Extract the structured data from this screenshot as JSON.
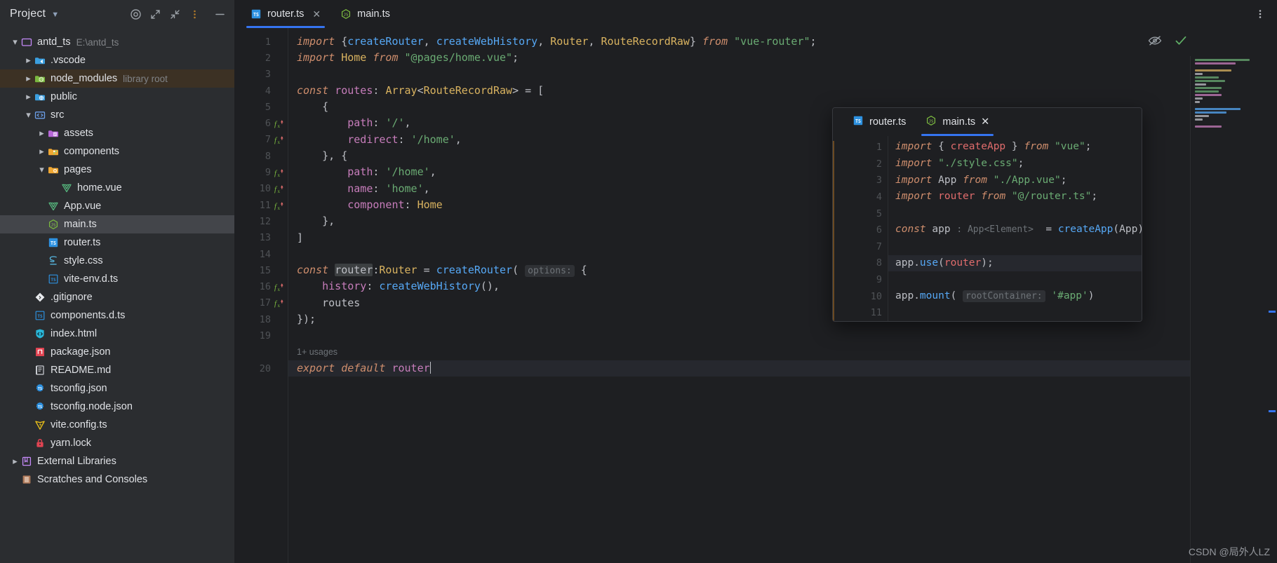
{
  "sidebar": {
    "title": "Project",
    "toolbar_icons": [
      "target-icon",
      "expand-icon",
      "collapse-icon",
      "more-vertical-icon",
      "minimize-icon"
    ],
    "tree": [
      {
        "label": "antd_ts",
        "sub": "E:\\antd_ts",
        "arrow": "down",
        "icon": "folder-module-icon",
        "indent": 0,
        "state": ""
      },
      {
        "label": ".vscode",
        "sub": "",
        "arrow": "right",
        "icon": "folder-vscode-icon",
        "indent": 1,
        "state": ""
      },
      {
        "label": "node_modules",
        "sub": "library root",
        "arrow": "right",
        "icon": "folder-node-icon",
        "indent": 1,
        "state": "sel-brown"
      },
      {
        "label": "public",
        "sub": "",
        "arrow": "right",
        "icon": "folder-web-icon",
        "indent": 1,
        "state": ""
      },
      {
        "label": "src",
        "sub": "",
        "arrow": "down",
        "icon": "folder-source-icon",
        "indent": 1,
        "state": ""
      },
      {
        "label": "assets",
        "sub": "",
        "arrow": "right",
        "icon": "folder-assets-icon",
        "indent": 2,
        "state": ""
      },
      {
        "label": "components",
        "sub": "",
        "arrow": "right",
        "icon": "folder-components-icon",
        "indent": 2,
        "state": ""
      },
      {
        "label": "pages",
        "sub": "",
        "arrow": "down",
        "icon": "folder-pages-icon",
        "indent": 2,
        "state": ""
      },
      {
        "label": "home.vue",
        "sub": "",
        "arrow": "none",
        "icon": "vue-file-icon",
        "indent": 3,
        "state": ""
      },
      {
        "label": "App.vue",
        "sub": "",
        "arrow": "none",
        "icon": "vue-file-icon",
        "indent": 2,
        "state": ""
      },
      {
        "label": "main.ts",
        "sub": "",
        "arrow": "none",
        "icon": "node-js-file-icon",
        "indent": 2,
        "state": "sel-blue"
      },
      {
        "label": "router.ts",
        "sub": "",
        "arrow": "none",
        "icon": "typescript-file-icon",
        "indent": 2,
        "state": ""
      },
      {
        "label": "style.css",
        "sub": "",
        "arrow": "none",
        "icon": "css-file-icon",
        "indent": 2,
        "state": ""
      },
      {
        "label": "vite-env.d.ts",
        "sub": "",
        "arrow": "none",
        "icon": "typescript-dts-file-icon",
        "indent": 2,
        "state": ""
      },
      {
        "label": ".gitignore",
        "sub": "",
        "arrow": "none",
        "icon": "git-file-icon",
        "indent": 1,
        "state": ""
      },
      {
        "label": "components.d.ts",
        "sub": "",
        "arrow": "none",
        "icon": "typescript-dts-file-icon",
        "indent": 1,
        "state": ""
      },
      {
        "label": "index.html",
        "sub": "",
        "arrow": "none",
        "icon": "html-file-icon",
        "indent": 1,
        "state": ""
      },
      {
        "label": "package.json",
        "sub": "",
        "arrow": "none",
        "icon": "npm-file-icon",
        "indent": 1,
        "state": ""
      },
      {
        "label": "README.md",
        "sub": "",
        "arrow": "none",
        "icon": "markdown-file-icon",
        "indent": 1,
        "state": ""
      },
      {
        "label": "tsconfig.json",
        "sub": "",
        "arrow": "none",
        "icon": "tsconfig-file-icon",
        "indent": 1,
        "state": ""
      },
      {
        "label": "tsconfig.node.json",
        "sub": "",
        "arrow": "none",
        "icon": "tsconfig-file-icon",
        "indent": 1,
        "state": ""
      },
      {
        "label": "vite.config.ts",
        "sub": "",
        "arrow": "none",
        "icon": "vite-file-icon",
        "indent": 1,
        "state": ""
      },
      {
        "label": "yarn.lock",
        "sub": "",
        "arrow": "none",
        "icon": "lock-file-icon",
        "indent": 1,
        "state": ""
      },
      {
        "label": "External Libraries",
        "sub": "",
        "arrow": "right",
        "icon": "libraries-icon",
        "indent": 0,
        "state": ""
      },
      {
        "label": "Scratches and Consoles",
        "sub": "",
        "arrow": "none",
        "icon": "scratches-icon",
        "indent": 0,
        "state": ""
      }
    ]
  },
  "editor": {
    "tabs": [
      {
        "label": "router.ts",
        "icon": "typescript-file-icon",
        "active": true,
        "closable": true
      },
      {
        "label": "main.ts",
        "icon": "node-js-file-icon",
        "active": false,
        "closable": false
      }
    ],
    "more_icon": "more-vertical-icon",
    "inspection_icons": [
      "eye-off-icon",
      "checkmark-ok-icon"
    ],
    "usage_hint": "1+ usages",
    "line_numbers": [
      "1",
      "2",
      "3",
      "4",
      "5",
      "6",
      "7",
      "8",
      "9",
      "10",
      "11",
      "12",
      "13",
      "14",
      "15",
      "16",
      "17",
      "18",
      "19",
      "20"
    ],
    "modified_lines": [
      6,
      7,
      9,
      10,
      11,
      16,
      17
    ],
    "code_lines": [
      "import {createRouter, createWebHistory, Router, RouteRecordRaw} from \"vue-router\";",
      "import Home from \"@pages/home.vue\";",
      "",
      "const routes: Array<RouteRecordRaw> = [",
      "    {",
      "        path: '/',",
      "        redirect: '/home',",
      "    }, {",
      "        path: '/home',",
      "        name: 'home',",
      "        component: Home",
      "    },",
      "]",
      "",
      "const router:Router = createRouter( options: {",
      "    history: createWebHistory(),",
      "    routes",
      "});",
      "",
      "export default router"
    ],
    "inlay_hints": [
      {
        "line": 15,
        "text": "options:"
      }
    ]
  },
  "popup": {
    "tabs": [
      {
        "label": "router.ts",
        "icon": "typescript-file-icon",
        "active": false,
        "closable": false
      },
      {
        "label": "main.ts",
        "icon": "node-js-file-icon",
        "active": true,
        "closable": true
      }
    ],
    "line_numbers": [
      "1",
      "2",
      "3",
      "4",
      "5",
      "6",
      "7",
      "8",
      "9",
      "10",
      "11"
    ],
    "caret_line": 8,
    "code_lines": [
      "import { createApp } from \"vue\";",
      "import \"./style.css\";",
      "import App from \"./App.vue\";",
      "import router from \"@/router.ts\";",
      "",
      "const app : App<Element>  = createApp(App);",
      "",
      "app.use(router);",
      "",
      "app.mount( rootContainer: '#app')",
      ""
    ],
    "inlay_hints": [
      {
        "line": 6,
        "text": ": App<Element>"
      },
      {
        "line": 10,
        "text": "rootContainer:"
      }
    ]
  },
  "watermark": "CSDN @局外人LZ",
  "colors": {
    "accent": "#3574f0",
    "bg_editor": "#1e1f22",
    "bg_panel": "#2b2d30",
    "selection_blue": "#43454a",
    "selection_brown": "#3c3124",
    "keyword": "#cf8e6d",
    "string": "#6aab73",
    "function": "#56a8f5",
    "property": "#c77dbb",
    "class": "#d9b360",
    "text": "#bcbec4",
    "line_number": "#4f5256",
    "hint": "#6e7378"
  }
}
